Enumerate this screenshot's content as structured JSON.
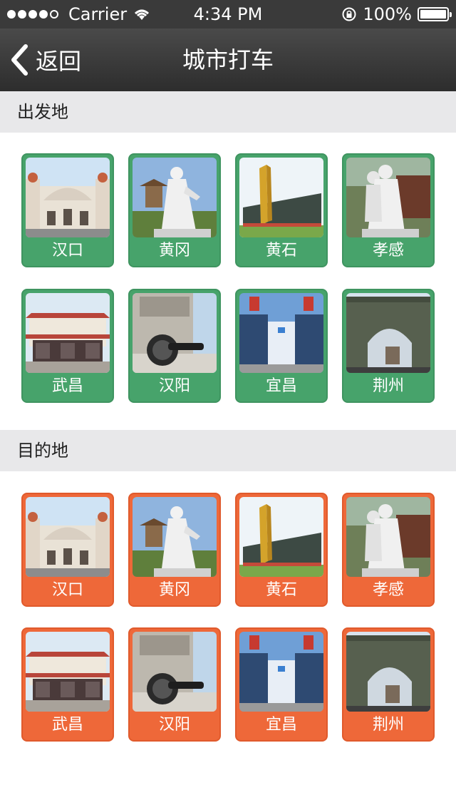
{
  "status_bar": {
    "carrier": "Carrier",
    "time": "4:34 PM",
    "battery": "100%",
    "signal_dots_filled": 4,
    "signal_dots_total": 5
  },
  "nav": {
    "back_label": "返回",
    "title": "城市打车"
  },
  "departure": {
    "title": "出发地",
    "accent": "#47a36b",
    "cities": [
      {
        "name": "汉口",
        "image": "hankou-station"
      },
      {
        "name": "黄冈",
        "image": "huanggang-statue"
      },
      {
        "name": "黄石",
        "image": "huangshi-monument"
      },
      {
        "name": "孝感",
        "image": "xiaogan-statue"
      },
      {
        "name": "武昌",
        "image": "wuchang-station"
      },
      {
        "name": "汉阳",
        "image": "hanyang-cannon"
      },
      {
        "name": "宜昌",
        "image": "yichang-station"
      },
      {
        "name": "荆州",
        "image": "jingzhou-gate"
      }
    ]
  },
  "destination": {
    "title": "目的地",
    "accent": "#ee6839",
    "cities": [
      {
        "name": "汉口",
        "image": "hankou-station"
      },
      {
        "name": "黄冈",
        "image": "huanggang-statue"
      },
      {
        "name": "黄石",
        "image": "huangshi-monument"
      },
      {
        "name": "孝感",
        "image": "xiaogan-statue"
      },
      {
        "name": "武昌",
        "image": "wuchang-station"
      },
      {
        "name": "汉阳",
        "image": "hanyang-cannon"
      },
      {
        "name": "宜昌",
        "image": "yichang-station"
      },
      {
        "name": "荆州",
        "image": "jingzhou-gate"
      }
    ]
  }
}
